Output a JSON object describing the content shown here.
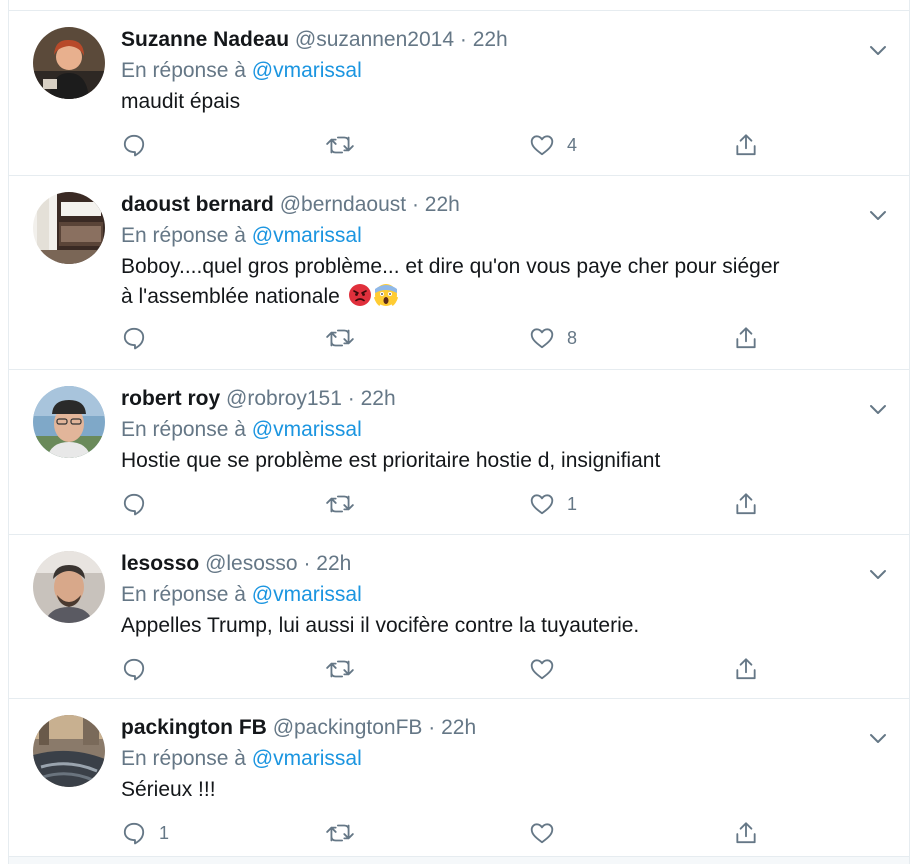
{
  "colors": {
    "accent": "#1b95e0",
    "secondary_text": "#657786",
    "border": "#e6ecf0"
  },
  "tweets": [
    {
      "name": "Suzanne Nadeau",
      "handle": "@suzannen2014",
      "dot": "·",
      "time": "22h",
      "reply_prefix": "En réponse à",
      "reply_to": "@vmarissal",
      "text": "maudit épais",
      "replies": "",
      "retweets": "",
      "likes": "4"
    },
    {
      "name": "daoust bernard",
      "handle": "@berndaoust",
      "dot": "·",
      "time": "22h",
      "reply_prefix": "En réponse à",
      "reply_to": "@vmarissal",
      "text_line1": "Boboy....quel gros problème... et dire qu'on vous paye cher pour siéger",
      "text_line2": "à l'assemblée nationale",
      "emojis": [
        "angry-face-emoji",
        "screaming-face-emoji"
      ],
      "replies": "",
      "retweets": "",
      "likes": "8"
    },
    {
      "name": "robert roy",
      "handle": "@robroy151",
      "dot": "·",
      "time": "22h",
      "reply_prefix": "En réponse à",
      "reply_to": "@vmarissal",
      "text": "Hostie que se problème est prioritaire hostie d, insignifiant",
      "replies": "",
      "retweets": "",
      "likes": "1"
    },
    {
      "name": "lesosso",
      "handle": "@lesosso",
      "dot": "·",
      "time": "22h",
      "reply_prefix": "En réponse à",
      "reply_to": "@vmarissal",
      "text": "Appelles Trump, lui aussi il vocifère contre la tuyauterie.",
      "replies": "",
      "retweets": "",
      "likes": ""
    },
    {
      "name": "packington FB",
      "handle": "@packingtonFB",
      "dot": "·",
      "time": "22h",
      "reply_prefix": "En réponse à",
      "reply_to": "@vmarissal",
      "text": "Sérieux !!!",
      "replies": "1",
      "retweets": "",
      "likes": ""
    }
  ],
  "icons": {
    "reply": "reply-bubble-icon",
    "retweet": "retweet-arrows-icon",
    "like": "heart-icon",
    "share": "share-upload-icon",
    "menu": "chevron-down-icon"
  }
}
